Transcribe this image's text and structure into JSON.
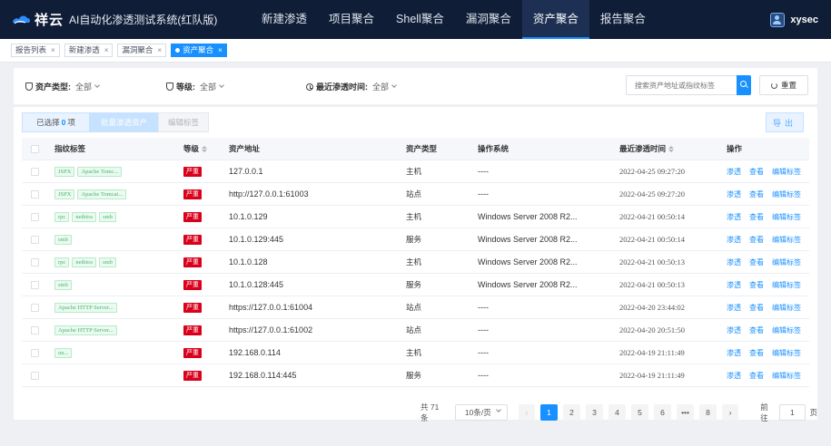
{
  "app": {
    "logo_name": "祥云",
    "title": "AI自动化渗透测试系统(红队版)",
    "user": "xysec"
  },
  "nav": [
    {
      "label": "新建渗透",
      "active": false
    },
    {
      "label": "项目聚合",
      "active": false
    },
    {
      "label": "Shell聚合",
      "active": false
    },
    {
      "label": "漏洞聚合",
      "active": false
    },
    {
      "label": "资产聚合",
      "active": true
    },
    {
      "label": "报告聚合",
      "active": false
    }
  ],
  "tabs": [
    {
      "label": "报告列表",
      "active": false
    },
    {
      "label": "新建渗透",
      "active": false
    },
    {
      "label": "漏洞聚合",
      "active": false
    },
    {
      "label": "资产聚合",
      "active": true
    }
  ],
  "filters": {
    "asset_type": {
      "label": "资产类型:",
      "value": "全部"
    },
    "level": {
      "label": "等级:",
      "value": "全部"
    },
    "recent_time": {
      "label": "最近渗透时间:",
      "value": "全部"
    },
    "search_placeholder": "搜索资产地址或指纹标签",
    "reset_label": "重置"
  },
  "toolbar": {
    "selected_prefix": "已选择",
    "selected_count": "0",
    "selected_suffix": "项",
    "batch_label": "批量渗透资产",
    "edit_label": "编辑标签",
    "export_label": "导出"
  },
  "table": {
    "headers": {
      "fingerprint": "指纹标签",
      "level": "等级",
      "address": "资产地址",
      "type": "资产类型",
      "os": "操作系统",
      "time": "最近渗透时间",
      "actions": "操作"
    },
    "action_labels": [
      "渗透",
      "查看",
      "编辑标签"
    ],
    "rows": [
      {
        "tags": [
          "JSPX",
          "Apache Tomc..."
        ],
        "level": "严重",
        "address": "127.0.0.1",
        "type": "主机",
        "os": "----",
        "time": "2022-04-25 09:27:20"
      },
      {
        "tags": [
          "JSPX",
          "Apache Tomcat..."
        ],
        "level": "严重",
        "address": "http://127.0.0.1:61003",
        "type": "站点",
        "os": "----",
        "time": "2022-04-25 09:27:20"
      },
      {
        "tags": [
          "rpc",
          "netbios",
          "smb"
        ],
        "level": "严重",
        "address": "10.1.0.129",
        "type": "主机",
        "os": "Windows Server 2008 R2...",
        "time": "2022-04-21 00:50:14"
      },
      {
        "tags": [
          "smb"
        ],
        "level": "严重",
        "address": "10.1.0.129:445",
        "type": "服务",
        "os": "Windows Server 2008 R2...",
        "time": "2022-04-21 00:50:14"
      },
      {
        "tags": [
          "rpc",
          "netbios",
          "smb"
        ],
        "level": "严重",
        "address": "10.1.0.128",
        "type": "主机",
        "os": "Windows Server 2008 R2...",
        "time": "2022-04-21 00:50:13"
      },
      {
        "tags": [
          "smb"
        ],
        "level": "严重",
        "address": "10.1.0.128:445",
        "type": "服务",
        "os": "Windows Server 2008 R2...",
        "time": "2022-04-21 00:50:13"
      },
      {
        "tags": [
          "Apache HTTP Server..."
        ],
        "level": "严重",
        "address": "https://127.0.0.1:61004",
        "type": "站点",
        "os": "----",
        "time": "2022-04-20 23:44:02"
      },
      {
        "tags": [
          "Apache HTTP Server..."
        ],
        "level": "严重",
        "address": "https://127.0.0.1:61002",
        "type": "站点",
        "os": "----",
        "time": "2022-04-20 20:51:50"
      },
      {
        "tags": [
          "un..."
        ],
        "level": "严重",
        "address": "192.168.0.114",
        "type": "主机",
        "os": "----",
        "time": "2022-04-19 21:11:49"
      },
      {
        "tags": [],
        "level": "严重",
        "address": "192.168.0.114:445",
        "type": "服务",
        "os": "----",
        "time": "2022-04-19 21:11:49"
      }
    ]
  },
  "pagination": {
    "total": "共 71 条",
    "page_size": "10条/页",
    "pages": [
      "1",
      "2",
      "3",
      "4",
      "5",
      "6",
      "•••",
      "8"
    ],
    "current": "1",
    "goto_prefix": "前往",
    "goto_value": "1",
    "goto_suffix": "页"
  },
  "colors": {
    "topbar": "#0f1d36",
    "accent": "#1890ff",
    "severity_critical": "#d9001b",
    "tag_green": "#4bb56e"
  }
}
